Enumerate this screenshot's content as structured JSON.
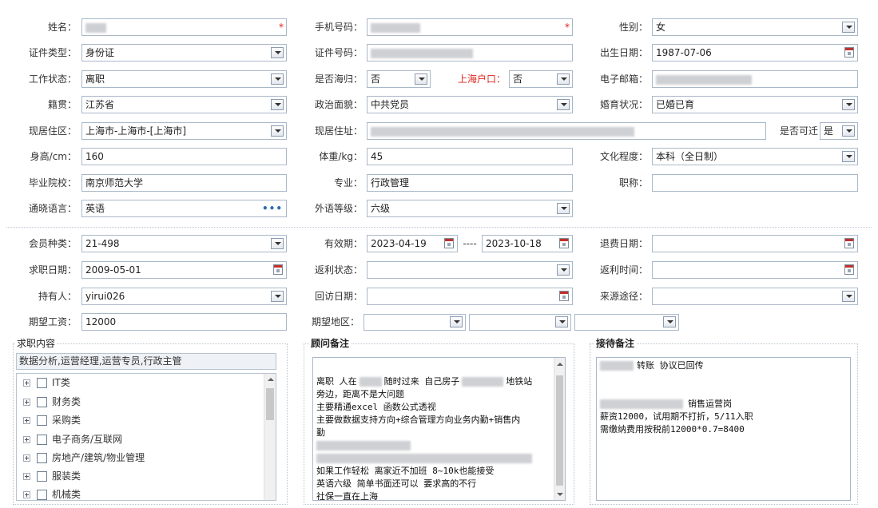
{
  "basic": {
    "name": {
      "label": "姓名：",
      "value": "",
      "required": "*"
    },
    "phone": {
      "label": "手机号码：",
      "value": "",
      "required": "*"
    },
    "gender": {
      "label": "性别：",
      "value": "女"
    },
    "id_type": {
      "label": "证件类型：",
      "value": "身份证"
    },
    "id_number": {
      "label": "证件号码：",
      "value": ""
    },
    "birth_date": {
      "label": "出生日期：",
      "value": "1987-07-06"
    },
    "work_status": {
      "label": "工作状态：",
      "value": "离职"
    },
    "returnee": {
      "label": "是否海归：",
      "value": "否"
    },
    "shanghai_hukou": {
      "label": "上海户口：",
      "value": "否"
    },
    "email": {
      "label": "电子邮箱：",
      "value": ""
    },
    "native_place": {
      "label": "籍贯：",
      "value": "江苏省"
    },
    "political": {
      "label": "政治面貌：",
      "value": "中共党员"
    },
    "marital": {
      "label": "婚育状况：",
      "value": "已婚已育"
    },
    "residence_area": {
      "label": "现居住区：",
      "value": "上海市-上海市-[上海市]"
    },
    "residence_address": {
      "label": "现居住址：",
      "value": ""
    },
    "relocatable": {
      "label": "是否可迁",
      "value": "是"
    },
    "height": {
      "label": "身高/cm：",
      "value": "160"
    },
    "weight": {
      "label": "体重/kg：",
      "value": "45"
    },
    "education": {
      "label": "文化程度：",
      "value": "本科（全日制）"
    },
    "school": {
      "label": "毕业院校：",
      "value": "南京师范大学"
    },
    "major": {
      "label": "专业：",
      "value": "行政管理"
    },
    "title": {
      "label": "职称：",
      "value": ""
    },
    "languages": {
      "label": "通晓语言：",
      "value": "英语"
    },
    "language_level": {
      "label": "外语等级：",
      "value": "六级"
    }
  },
  "membership": {
    "member_type": {
      "label": "会员种类：",
      "value": "21-498"
    },
    "validity": {
      "label": "有效期：",
      "start": "2023-04-19",
      "separator": "----",
      "end": "2023-10-18"
    },
    "refund_date": {
      "label": "退费日期：",
      "value": ""
    },
    "job_seek_date": {
      "label": "求职日期：",
      "value": "2009-05-01"
    },
    "rebate_status": {
      "label": "返利状态：",
      "value": ""
    },
    "rebate_time": {
      "label": "返利时间：",
      "value": ""
    },
    "holder": {
      "label": "持有人：",
      "value": "yirui026"
    },
    "revisit_date": {
      "label": "回访日期：",
      "value": ""
    },
    "source": {
      "label": "来源途径：",
      "value": ""
    },
    "expected_salary": {
      "label": "期望工资：",
      "value": "12000"
    },
    "expected_area": {
      "label": "期望地区：",
      "values": [
        "",
        "",
        ""
      ]
    }
  },
  "job_content": {
    "title": "求职内容",
    "summary": "数据分析,运营经理,运营专员,行政主管",
    "categories": [
      "IT类",
      "财务类",
      "采购类",
      "电子商务/互联网",
      "房地产/建筑/物业管理",
      "服装类",
      "机械类"
    ]
  },
  "consultant_notes": {
    "title": "顾问备注",
    "lines": [
      "离职 人在",
      "随时过来 自己房子",
      "地铁站",
      "旁边，距离不是大问题",
      "主要精通excel 函数公式透视",
      "主要做数据支持方向+综合管理方向业务内勤+销售内",
      "勤",
      "如果工作轻松 离家近不加班 8~10k也能接受",
      "英语六级 简单书面还可以 要求高的不行",
      "社保一直在上海"
    ]
  },
  "reception_notes": {
    "title": "接待备注",
    "line1_suffix": "转账 协议已回传",
    "line2_suffix": "销售运营岗",
    "line3": "薪资12000，试用期不打折，5/11入职",
    "line4": "需缴纳费用按税前12000*0.7=8400"
  }
}
